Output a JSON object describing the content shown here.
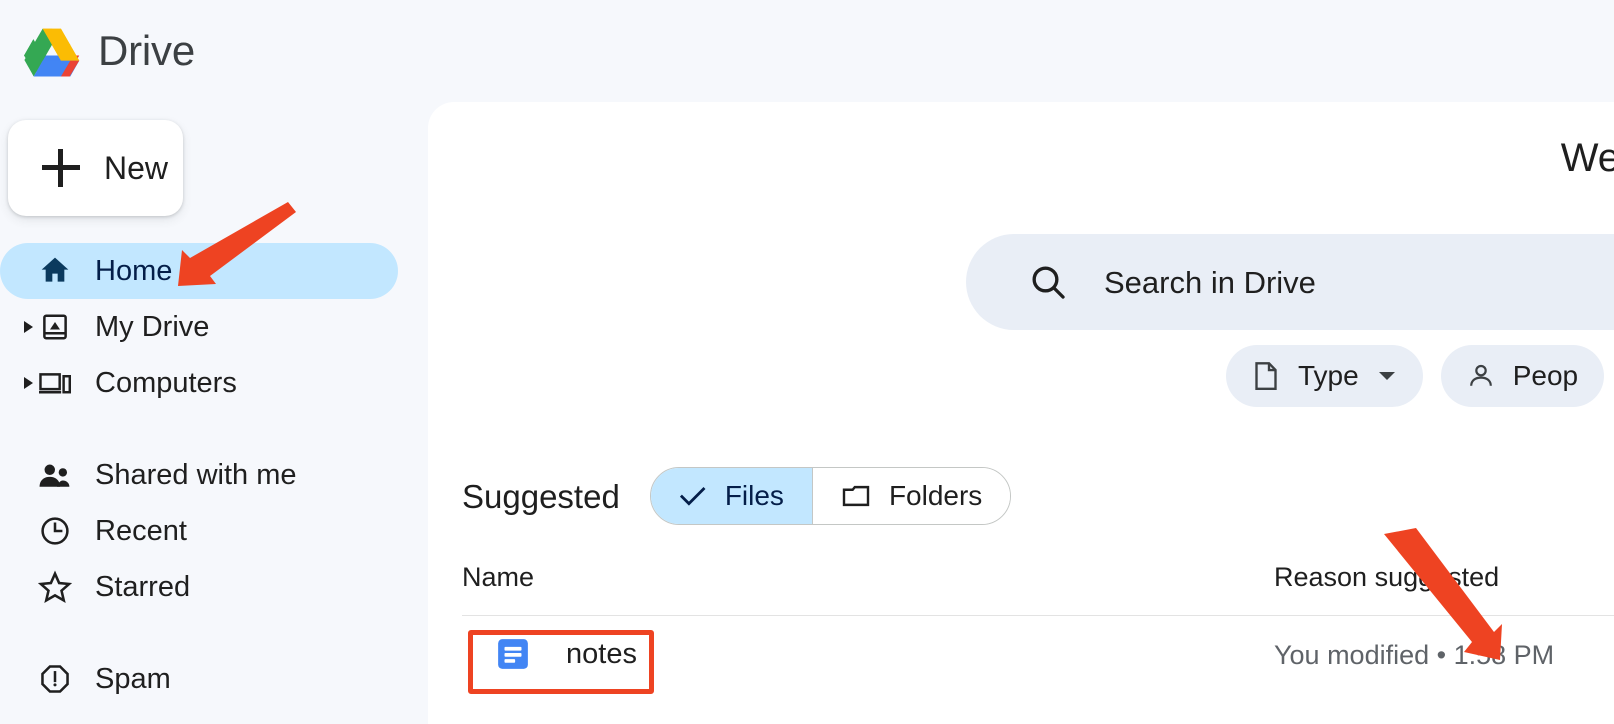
{
  "app": {
    "brand_name": "Drive",
    "logo_icon": "google-drive-logo",
    "accent_selected": "#c2e7ff",
    "annotation_color": "#ee4322",
    "page_background": "#f6f8fc",
    "panel_background": "#ffffff"
  },
  "sidebar": {
    "new_button": {
      "label": "New",
      "icon": "plus-icon"
    },
    "items": [
      {
        "label": "Home",
        "icon": "home-icon",
        "selected": true,
        "expandable": false
      },
      {
        "label": "My Drive",
        "icon": "my-drive-icon",
        "selected": false,
        "expandable": true
      },
      {
        "label": "Computers",
        "icon": "computer-icon",
        "selected": false,
        "expandable": true
      },
      {
        "label": "Shared with me",
        "icon": "people-icon",
        "selected": false,
        "expandable": false
      },
      {
        "label": "Recent",
        "icon": "clock-icon",
        "selected": false,
        "expandable": false
      },
      {
        "label": "Starred",
        "icon": "star-icon",
        "selected": false,
        "expandable": false
      },
      {
        "label": "Spam",
        "icon": "spam-icon",
        "selected": false,
        "expandable": false
      }
    ]
  },
  "main": {
    "welcome_heading": "We",
    "search": {
      "icon": "search-icon",
      "placeholder": "Search in Drive",
      "value": ""
    },
    "filter_chips": [
      {
        "label": "Type",
        "icon": "file-icon",
        "has_dropdown": true
      },
      {
        "label": "Peop",
        "icon": "person-icon",
        "has_dropdown": false
      }
    ],
    "suggested": {
      "title": "Suggested",
      "toggle": [
        {
          "label": "Files",
          "icon": "check-icon",
          "active": true
        },
        {
          "label": "Folders",
          "icon": "folder-icon",
          "active": false
        }
      ],
      "columns": [
        "Name",
        "Reason suggested"
      ],
      "rows": [
        {
          "name": "notes",
          "file_icon": "google-docs-icon",
          "reason": "You modified • 1:58 PM",
          "highlighted": true
        }
      ]
    }
  },
  "annotations": [
    {
      "type": "arrow",
      "target": "sidebar-item-home",
      "direction": "down-left",
      "color": "#ee4322"
    },
    {
      "type": "arrow",
      "target": "reason-suggested-cell",
      "direction": "down-right",
      "color": "#ee4322"
    },
    {
      "type": "box",
      "target": "file-cell-notes",
      "color": "#ee4322"
    }
  ]
}
